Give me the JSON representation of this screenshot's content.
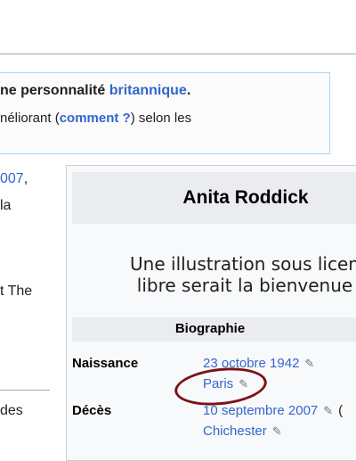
{
  "notice": {
    "line1_prefix": "ne personnalité ",
    "line1_link": "britannique",
    "line1_suffix": ".",
    "line2_prefix": "néliorant (",
    "line2_link": "comment ?",
    "line2_suffix": ") selon les"
  },
  "article": {
    "fragment_year": "007",
    "fragment_comma": ",",
    "fragment_la": "la",
    "fragment_the": "t The",
    "fragment_des": "des"
  },
  "infobox": {
    "title": "Anita Roddick",
    "illustration_line1": "Une illustration sous licen",
    "illustration_line2": "libre serait la bienvenue",
    "section": "Biographie",
    "birth": {
      "label": "Naissance",
      "date": "23 octobre 1942",
      "place": "Paris"
    },
    "death": {
      "label": "Décès",
      "date": "10 septembre 2007",
      "trailing": "(",
      "place": "Chichester"
    },
    "edit_icon": "pencil-icon",
    "highlight_color": "#7d1216"
  }
}
